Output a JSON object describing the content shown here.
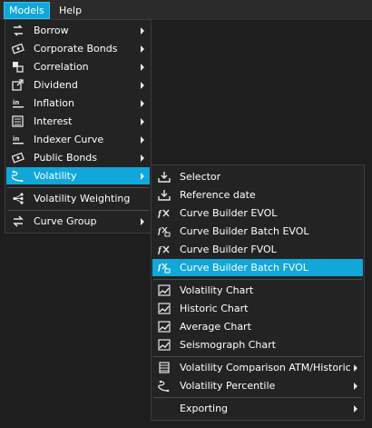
{
  "menubar": {
    "items": [
      {
        "label": "Models"
      },
      {
        "label": "Help"
      }
    ]
  },
  "models_menu": {
    "items": [
      {
        "label": "Borrow",
        "icon": "borrow-icon"
      },
      {
        "label": "Corporate Bonds",
        "icon": "corporate-bonds-icon"
      },
      {
        "label": "Correlation",
        "icon": "correlation-icon"
      },
      {
        "label": "Dividend",
        "icon": "dividend-icon"
      },
      {
        "label": "Inflation",
        "icon": "inflation-icon"
      },
      {
        "label": "Interest",
        "icon": "interest-icon"
      },
      {
        "label": "Indexer Curve",
        "icon": "indexer-curve-icon"
      },
      {
        "label": "Public Bonds",
        "icon": "public-bonds-icon"
      },
      {
        "label": "Volatility",
        "icon": "volatility-icon"
      },
      {
        "label": "Volatility Weighting",
        "icon": "volatility-weighting-icon"
      },
      {
        "label": "Curve Group",
        "icon": "curve-group-icon"
      }
    ]
  },
  "volatility_menu": {
    "items": [
      {
        "label": "Selector",
        "icon": "download-icon"
      },
      {
        "label": "Reference date",
        "icon": "download-icon"
      },
      {
        "label": "Curve Builder EVOL",
        "icon": "curve-builder-icon"
      },
      {
        "label": "Curve Builder Batch EVOL",
        "icon": "curve-builder-batch-icon"
      },
      {
        "label": "Curve Builder FVOL",
        "icon": "curve-builder-icon"
      },
      {
        "label": "Curve Builder Batch FVOL",
        "icon": "curve-builder-batch-icon"
      },
      {
        "label": "Volatility Chart",
        "icon": "chart-icon"
      },
      {
        "label": "Historic Chart",
        "icon": "chart-icon"
      },
      {
        "label": "Average Chart",
        "icon": "chart-icon"
      },
      {
        "label": "Seismograph Chart",
        "icon": "chart-icon"
      },
      {
        "label": "Volatility Comparison ATM/Historic",
        "icon": "table-icon"
      },
      {
        "label": "Volatility Percentile",
        "icon": "percentile-icon"
      },
      {
        "label": "Exporting",
        "icon": ""
      }
    ]
  },
  "colors": {
    "accent": "#11a7d8",
    "menu_bg": "#232323",
    "menubar_bg": "#2b2b2b",
    "window_bg": "#1e1e1e"
  }
}
